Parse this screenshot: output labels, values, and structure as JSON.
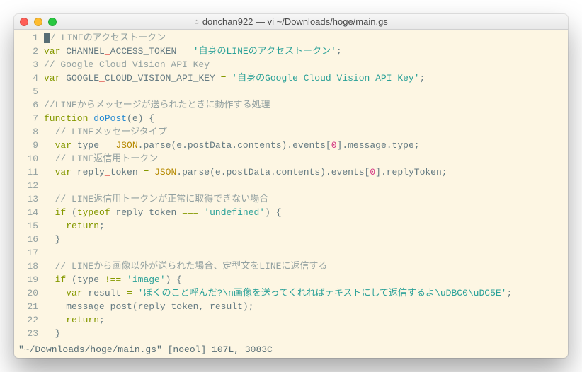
{
  "window": {
    "title": "donchan922 — vi ~/Downloads/hoge/main.gs"
  },
  "status_line": "\"~/Downloads/hoge/main.gs\" [noeol] 107L, 3083C",
  "code_lines": [
    {
      "n": 1,
      "tokens": [
        {
          "cls": "cursor",
          "t": ""
        },
        {
          "cls": "c-comment",
          "t": "/ LINEのアクセストークン"
        }
      ]
    },
    {
      "n": 2,
      "tokens": [
        {
          "cls": "c-key",
          "t": "var"
        },
        {
          "cls": "c-default",
          "t": " CHANNEL"
        },
        {
          "cls": "c-red",
          "t": "_"
        },
        {
          "cls": "c-default",
          "t": "ACCESS_TOKEN "
        },
        {
          "cls": "c-key",
          "t": "="
        },
        {
          "cls": "c-default",
          "t": " "
        },
        {
          "cls": "c-str",
          "t": "'自身のLINEのアクセストークン'"
        },
        {
          "cls": "c-default",
          "t": ";"
        }
      ]
    },
    {
      "n": 3,
      "tokens": [
        {
          "cls": "c-comment",
          "t": "// Google Cloud Vision API Key"
        }
      ]
    },
    {
      "n": 4,
      "tokens": [
        {
          "cls": "c-key",
          "t": "var"
        },
        {
          "cls": "c-default",
          "t": " GOOGLE"
        },
        {
          "cls": "c-red",
          "t": "_"
        },
        {
          "cls": "c-default",
          "t": "CLOUD_VISION_API_KEY "
        },
        {
          "cls": "c-key",
          "t": "="
        },
        {
          "cls": "c-default",
          "t": " "
        },
        {
          "cls": "c-str",
          "t": "'自身のGoogle Cloud Vision API Key'"
        },
        {
          "cls": "c-default",
          "t": ";"
        }
      ]
    },
    {
      "n": 5,
      "tokens": [
        {
          "cls": "c-default",
          "t": ""
        }
      ]
    },
    {
      "n": 6,
      "tokens": [
        {
          "cls": "c-comment",
          "t": "//LINEからメッセージが送られたときに動作する処理"
        }
      ]
    },
    {
      "n": 7,
      "tokens": [
        {
          "cls": "c-key",
          "t": "function"
        },
        {
          "cls": "c-default",
          "t": " "
        },
        {
          "cls": "c-blue",
          "t": "doPost"
        },
        {
          "cls": "c-default",
          "t": "(e) {"
        }
      ]
    },
    {
      "n": 8,
      "tokens": [
        {
          "cls": "c-default",
          "t": "  "
        },
        {
          "cls": "c-comment",
          "t": "// LINEメッセージタイプ"
        }
      ]
    },
    {
      "n": 9,
      "tokens": [
        {
          "cls": "c-default",
          "t": "  "
        },
        {
          "cls": "c-key",
          "t": "var"
        },
        {
          "cls": "c-default",
          "t": " type "
        },
        {
          "cls": "c-key",
          "t": "="
        },
        {
          "cls": "c-default",
          "t": " "
        },
        {
          "cls": "c-type",
          "t": "JSON"
        },
        {
          "cls": "c-default",
          "t": ".parse(e.postData.contents).events["
        },
        {
          "cls": "c-num",
          "t": "0"
        },
        {
          "cls": "c-default",
          "t": "].message.type;"
        }
      ]
    },
    {
      "n": 10,
      "tokens": [
        {
          "cls": "c-default",
          "t": "  "
        },
        {
          "cls": "c-comment",
          "t": "// LINE返信用トークン"
        }
      ]
    },
    {
      "n": 11,
      "tokens": [
        {
          "cls": "c-default",
          "t": "  "
        },
        {
          "cls": "c-key",
          "t": "var"
        },
        {
          "cls": "c-default",
          "t": " reply"
        },
        {
          "cls": "c-red",
          "t": "_"
        },
        {
          "cls": "c-default",
          "t": "token "
        },
        {
          "cls": "c-key",
          "t": "="
        },
        {
          "cls": "c-default",
          "t": " "
        },
        {
          "cls": "c-type",
          "t": "JSON"
        },
        {
          "cls": "c-default",
          "t": ".parse(e.postData.contents).events["
        },
        {
          "cls": "c-num",
          "t": "0"
        },
        {
          "cls": "c-default",
          "t": "].replyToken;"
        }
      ]
    },
    {
      "n": 12,
      "tokens": [
        {
          "cls": "c-default",
          "t": ""
        }
      ]
    },
    {
      "n": 13,
      "tokens": [
        {
          "cls": "c-default",
          "t": "  "
        },
        {
          "cls": "c-comment",
          "t": "// LINE返信用トークンが正常に取得できない場合"
        }
      ]
    },
    {
      "n": 14,
      "tokens": [
        {
          "cls": "c-default",
          "t": "  "
        },
        {
          "cls": "c-key",
          "t": "if"
        },
        {
          "cls": "c-default",
          "t": " ("
        },
        {
          "cls": "c-key",
          "t": "typeof"
        },
        {
          "cls": "c-default",
          "t": " reply"
        },
        {
          "cls": "c-red",
          "t": "_"
        },
        {
          "cls": "c-default",
          "t": "token "
        },
        {
          "cls": "c-key",
          "t": "==="
        },
        {
          "cls": "c-default",
          "t": " "
        },
        {
          "cls": "c-str",
          "t": "'undefined'"
        },
        {
          "cls": "c-default",
          "t": ") {"
        }
      ]
    },
    {
      "n": 15,
      "tokens": [
        {
          "cls": "c-default",
          "t": "    "
        },
        {
          "cls": "c-key",
          "t": "return"
        },
        {
          "cls": "c-default",
          "t": ";"
        }
      ]
    },
    {
      "n": 16,
      "tokens": [
        {
          "cls": "c-default",
          "t": "  }"
        }
      ]
    },
    {
      "n": 17,
      "tokens": [
        {
          "cls": "c-default",
          "t": ""
        }
      ]
    },
    {
      "n": 18,
      "tokens": [
        {
          "cls": "c-default",
          "t": "  "
        },
        {
          "cls": "c-comment",
          "t": "// LINEから画像以外が送られた場合、定型文をLINEに返信する"
        }
      ]
    },
    {
      "n": 19,
      "tokens": [
        {
          "cls": "c-default",
          "t": "  "
        },
        {
          "cls": "c-key",
          "t": "if"
        },
        {
          "cls": "c-default",
          "t": " (type "
        },
        {
          "cls": "c-key",
          "t": "!=="
        },
        {
          "cls": "c-default",
          "t": " "
        },
        {
          "cls": "c-str",
          "t": "'image'"
        },
        {
          "cls": "c-default",
          "t": ") {"
        }
      ]
    },
    {
      "n": 20,
      "tokens": [
        {
          "cls": "c-default",
          "t": "    "
        },
        {
          "cls": "c-key",
          "t": "var"
        },
        {
          "cls": "c-default",
          "t": " result "
        },
        {
          "cls": "c-key",
          "t": "="
        },
        {
          "cls": "c-default",
          "t": " "
        },
        {
          "cls": "c-str",
          "t": "'ぼくのこと呼んだ?\\n画像を送ってくれればテキストにして返信するよ\\uDBC0\\uDC5E'"
        },
        {
          "cls": "c-default",
          "t": ";"
        }
      ]
    },
    {
      "n": 21,
      "tokens": [
        {
          "cls": "c-default",
          "t": "    message"
        },
        {
          "cls": "c-red",
          "t": "_"
        },
        {
          "cls": "c-default",
          "t": "post(reply"
        },
        {
          "cls": "c-red",
          "t": "_"
        },
        {
          "cls": "c-default",
          "t": "token, result);"
        }
      ]
    },
    {
      "n": 22,
      "tokens": [
        {
          "cls": "c-default",
          "t": "    "
        },
        {
          "cls": "c-key",
          "t": "return"
        },
        {
          "cls": "c-default",
          "t": ";"
        }
      ]
    },
    {
      "n": 23,
      "tokens": [
        {
          "cls": "c-default",
          "t": "  }"
        }
      ]
    }
  ]
}
